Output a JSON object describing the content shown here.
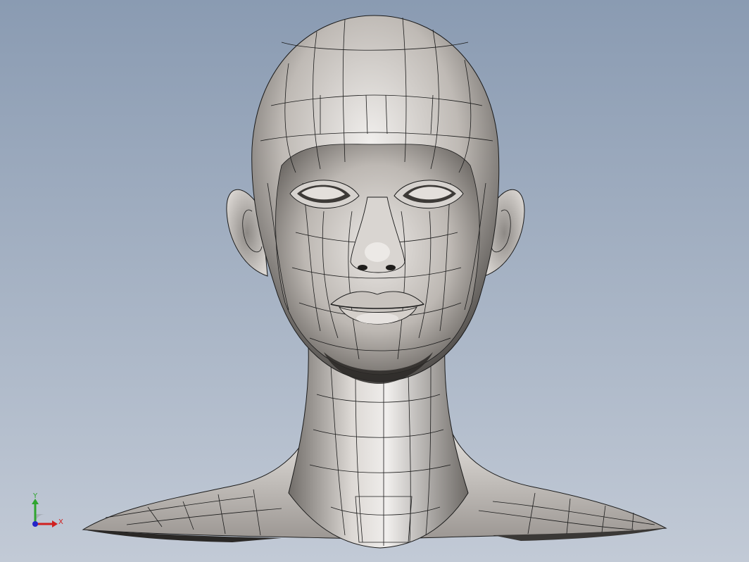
{
  "triad": {
    "y_label": "Y",
    "x_label": "X",
    "y_color": "#2fa52f",
    "x_color": "#d02020",
    "z_color": "#2424c8"
  },
  "model": {
    "surface_color": "#c9c4bf",
    "edge_color": "#1a1a1a"
  },
  "background": {
    "top_color": "#8a9bb2",
    "bottom_color": "#c2cad6"
  }
}
